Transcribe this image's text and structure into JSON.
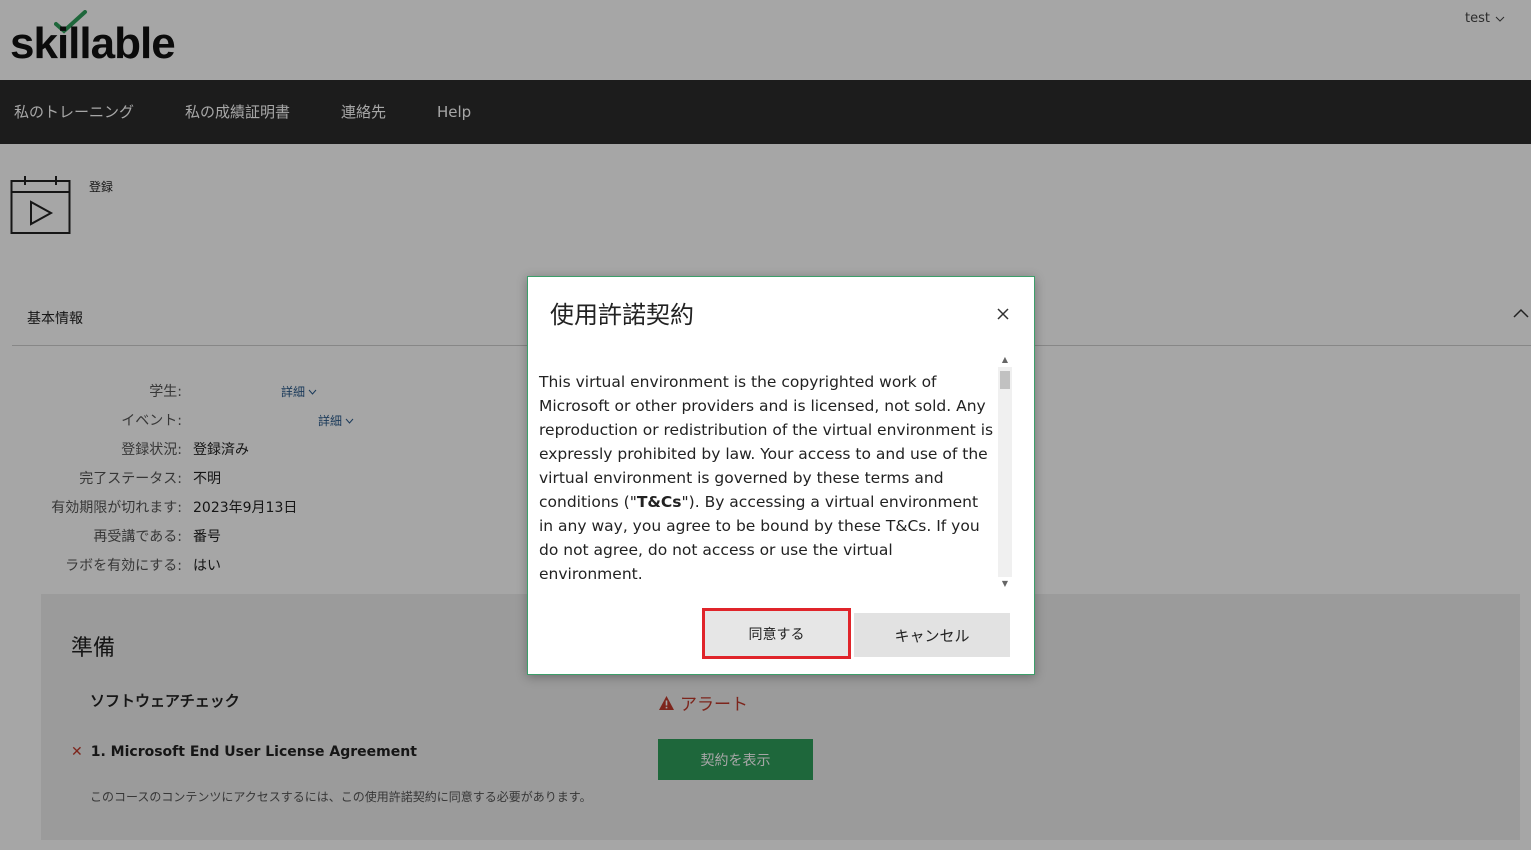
{
  "header": {
    "logo_text": "skillable",
    "user_name": "test"
  },
  "nav": {
    "items": [
      "私のトレーニング",
      "私の成績証明書",
      "連絡先",
      "Help"
    ]
  },
  "registration": {
    "label": "登録"
  },
  "basic_info": {
    "title": "基本情報",
    "detail_link": "詳細",
    "rows": [
      {
        "label": "学生:",
        "value": ""
      },
      {
        "label": "イベント:",
        "value": ""
      },
      {
        "label": "登録状況:",
        "value": "登録済み"
      },
      {
        "label": "完了ステータス:",
        "value": "不明"
      },
      {
        "label": "有効期限が切れます:",
        "value": "2023年9月13日"
      },
      {
        "label": "再受講である:",
        "value": "番号"
      },
      {
        "label": "ラボを有効にする:",
        "value": "はい"
      }
    ]
  },
  "preparation": {
    "title": "準備",
    "software_check": "ソフトウェアチェック",
    "alert": "アラート",
    "eula_item": "1. Microsoft End User License Agreement",
    "view_button": "契約を表示",
    "note": "このコースのコンテンツにアクセスするには、この使用許諾契約に同意する必要があります。"
  },
  "modal": {
    "title": "使用許諾契約",
    "body_before": "This virtual environment is the copyrighted work of Microsoft or other providers and is licensed, not sold. Any reproduction or redistribution of the virtual environment is expressly prohibited by law. Your access to and use of the virtual environment is governed by these terms and conditions (\"",
    "body_bold": "T&Cs",
    "body_after": "\"). By accessing a virtual environment in any way, you agree to be bound by these T&Cs. If you do not agree, do not access or use the virtual environment.",
    "agree_button": "同意する",
    "cancel_button": "キャンセル"
  },
  "colors": {
    "nav_bg": "#2b2b2b",
    "accent_green": "#2f9e5b",
    "alert_red": "#c0392b",
    "highlight_red": "#e0242a"
  }
}
